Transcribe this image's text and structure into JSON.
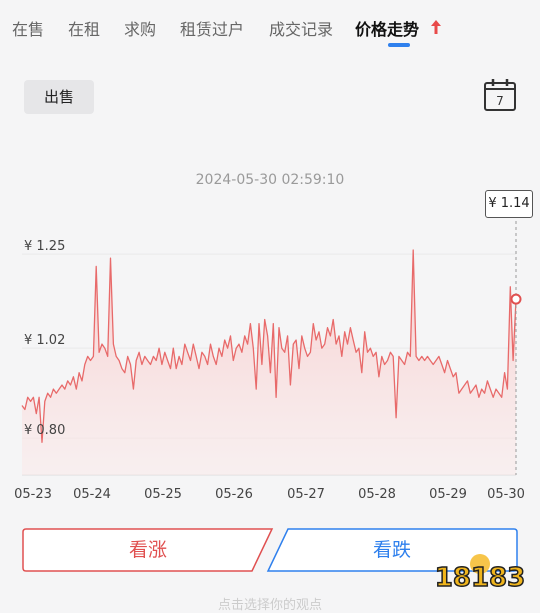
{
  "tabs": [
    {
      "label": "在售"
    },
    {
      "label": "在租"
    },
    {
      "label": "求购"
    },
    {
      "label": "租赁过户"
    },
    {
      "label": "成交记录"
    },
    {
      "label": "价格走势",
      "active": true
    }
  ],
  "filter": {
    "sell_label": "出售",
    "calendar_day": "7"
  },
  "chart_timestamp": "2024-05-30 02:59:10",
  "current_price_label": "¥ 1.14",
  "chart_data": {
    "type": "area",
    "x": [
      "05-23",
      "05-24",
      "05-25",
      "05-26",
      "05-27",
      "05-28",
      "05-29",
      "05-30"
    ],
    "y_tick_labels": [
      "¥ 1.25",
      "¥ 1.02",
      "¥ 0.80"
    ],
    "y_ticks": [
      1.25,
      1.02,
      0.8
    ],
    "ylim": [
      0.71,
      1.37
    ],
    "series": [
      {
        "color": "#e86a6a",
        "values": [
          0.88,
          0.87,
          0.9,
          0.89,
          0.9,
          0.86,
          0.9,
          0.79,
          0.89,
          0.91,
          0.9,
          0.92,
          0.91,
          0.92,
          0.93,
          0.92,
          0.94,
          0.93,
          0.95,
          0.92,
          0.96,
          0.94,
          0.98,
          1.0,
          0.99,
          1.0,
          1.22,
          1.01,
          1.03,
          1.02,
          1.0,
          1.24,
          1.03,
          1.0,
          0.99,
          0.97,
          0.96,
          1.0,
          0.98,
          0.92,
          0.99,
          1.01,
          0.98,
          1.0,
          0.99,
          0.98,
          1.0,
          0.99,
          1.02,
          0.98,
          1.01,
          0.99,
          0.97,
          1.02,
          0.97,
          1.0,
          0.98,
          1.03,
          1.01,
          0.99,
          1.03,
          1.0,
          0.97,
          1.01,
          1.0,
          0.98,
          1.03,
          1.0,
          0.98,
          1.02,
          1.0,
          1.04,
          1.02,
          1.05,
          0.99,
          1.02,
          1.03,
          1.01,
          1.05,
          1.03,
          1.08,
          1.02,
          0.92,
          1.08,
          0.98,
          1.09,
          1.05,
          0.96,
          1.08,
          0.9,
          1.07,
          1.02,
          1.01,
          1.05,
          0.93,
          1.03,
          1.04,
          0.97,
          1.05,
          1.02,
          1.0,
          1.01,
          1.08,
          1.04,
          1.06,
          1.02,
          1.03,
          1.07,
          1.05,
          1.09,
          1.03,
          1.05,
          1.0,
          1.06,
          1.03,
          1.07,
          1.04,
          1.01,
          1.02,
          0.96,
          1.06,
          1.01,
          1.02,
          1.0,
          1.01,
          0.95,
          1.0,
          0.98,
          0.99,
          1.01,
          1.0,
          0.85,
          1.0,
          0.99,
          0.98,
          1.01,
          1.0,
          1.26,
          1.0,
          0.99,
          1.0,
          0.99,
          1.0,
          0.99,
          0.98,
          0.99,
          1.0,
          0.98,
          0.96,
          0.99,
          0.97,
          0.95,
          0.96,
          0.91,
          0.92,
          0.93,
          0.94,
          0.91,
          0.92,
          0.93,
          0.9,
          0.92,
          0.91,
          0.94,
          0.92,
          0.9,
          0.92,
          0.91,
          0.9,
          0.96,
          0.92,
          1.17,
          0.99,
          1.14
        ]
      }
    ],
    "grid": true
  },
  "actions": {
    "up_label": "看涨",
    "down_label": "看跌"
  },
  "bottom_hint": "点击选择你的观点",
  "colors": {
    "up": "#e05050",
    "down": "#2f80ed",
    "line": "#e86a6a",
    "fill": "#fbdede"
  }
}
